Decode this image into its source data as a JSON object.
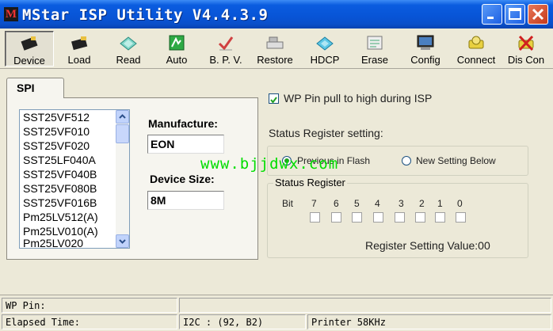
{
  "window": {
    "title": "MStar ISP Utility V4.4.3.9"
  },
  "toolbar": {
    "buttons": [
      {
        "label": "Device",
        "icon": "chip-icon"
      },
      {
        "label": "Load",
        "icon": "chip-load-icon"
      },
      {
        "label": "Read",
        "icon": "read-icon"
      },
      {
        "label": "Auto",
        "icon": "auto-icon"
      },
      {
        "label": "B. P. V.",
        "icon": "bpv-icon"
      },
      {
        "label": "Restore",
        "icon": "restore-icon"
      },
      {
        "label": "HDCP",
        "icon": "hdcp-icon"
      },
      {
        "label": "Erase",
        "icon": "erase-icon"
      },
      {
        "label": "Config",
        "icon": "config-icon"
      },
      {
        "label": "Connect",
        "icon": "connect-icon"
      },
      {
        "label": "Dis Con",
        "icon": "disconnect-icon"
      }
    ]
  },
  "device_panel": {
    "tab": "SPI",
    "device_list": [
      "SST25VF512",
      "SST25VF010",
      "SST25VF020",
      "SST25LF040A",
      "SST25VF040B",
      "SST25VF080B",
      "SST25VF016B",
      "Pm25LV512(A)",
      "Pm25LV010(A)",
      "Pm25LV020"
    ],
    "manufacture_label": "Manufacture:",
    "manufacture_value": "EON",
    "device_size_label": "Device Size:",
    "device_size_value": "8M"
  },
  "settings": {
    "wp_pin_label": "WP Pin pull to high during ISP",
    "wp_pin_checked": true,
    "status_register_setting_label": "Status Register setting:",
    "radio_previous": "Previous in Flash",
    "radio_new": "New Setting Below",
    "selected_radio": "previous",
    "status_register_group": "Status Register",
    "bit_label": "Bit",
    "bits": [
      "7",
      "6",
      "5",
      "4",
      "3",
      "2",
      "1",
      "0"
    ],
    "register_value_text": "Register Setting Value:00"
  },
  "watermark": "www.bjjdwx.com",
  "statusbar": {
    "wp_pin": "WP Pin:",
    "elapsed": "Elapsed Time:",
    "i2c": "I2C : (92, B2)",
    "printer": "Printer  58KHz"
  },
  "colors": {
    "title_bar": "#0854d6",
    "watermark": "#00dd00",
    "window_bg": "#ece9d8"
  }
}
